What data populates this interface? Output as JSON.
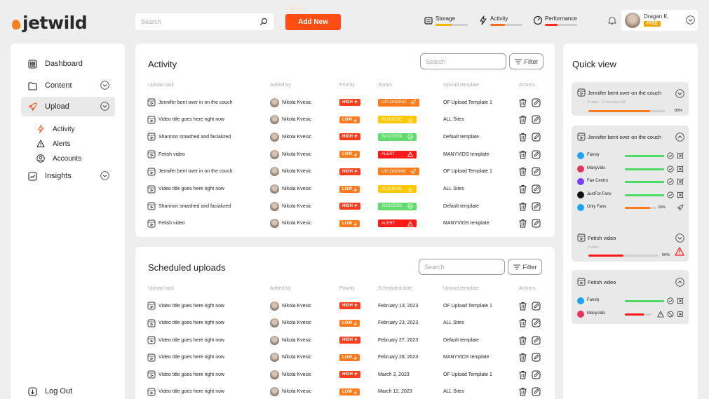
{
  "brand": {
    "name": "jetwild",
    "accent": "#ff4d14"
  },
  "header": {
    "search_placeholder": "Search",
    "ghost_label": "Upload",
    "add_new_label": "Add New",
    "meters": [
      {
        "label": "Storage",
        "icon": "storage-icon",
        "fraction": 0.5,
        "color": "#f5b400"
      },
      {
        "label": "Activity",
        "icon": "activity-icon",
        "fraction": 0.45,
        "color": "#ff6a1a"
      },
      {
        "label": "Performance",
        "icon": "performance-icon",
        "fraction": 0.4,
        "color": "#ff2a1a"
      }
    ],
    "user": {
      "name": "Dragan K.",
      "plan": "FREE"
    }
  },
  "sidebar": {
    "items": [
      {
        "label": "Dashboard",
        "icon": "dashboard-icon"
      },
      {
        "label": "Content",
        "icon": "folder-icon",
        "has_chevron": true
      },
      {
        "label": "Upload",
        "icon": "rocket-icon",
        "has_chevron": true,
        "active": true
      },
      {
        "label": "Insights",
        "icon": "chart-icon",
        "has_chevron": true
      }
    ],
    "sub_items": [
      {
        "label": "Activity",
        "icon": "activity-icon"
      },
      {
        "label": "Alerts",
        "icon": "warning-icon"
      },
      {
        "label": "Accounts",
        "icon": "user-circle-icon"
      }
    ],
    "logout_label": "Log Out"
  },
  "activity": {
    "title": "Activity",
    "search_placeholder": "Search",
    "filter_label": "Filter",
    "columns": [
      "Upload task",
      "Added by",
      "Priority",
      "Status",
      "Upload template",
      "Actions"
    ],
    "rows": [
      {
        "task": "Jennifer bent over in on the couch",
        "added_by": "Nikola Kvesic",
        "priority": "HIGH",
        "status": "UPLOADING",
        "template": "OF Upload Template 1"
      },
      {
        "task": "Video title goes here right now",
        "added_by": "Nikola Kvesic",
        "priority": "LOW",
        "status": "IN QUEUE",
        "template": "ALL Sites"
      },
      {
        "task": "Shannon smashed and facialized",
        "added_by": "Nikola Kvesic",
        "priority": "HIGH",
        "status": "SUCCESS",
        "template": "Default template"
      },
      {
        "task": "Fetish video",
        "added_by": "Nikola Kvesic",
        "priority": "LOW",
        "status": "ALERT",
        "template": "MANYVIDS template"
      },
      {
        "task": "Jennifer bent over in on the couch",
        "added_by": "Nikola Kvesic",
        "priority": "HIGH",
        "status": "UPLOADING",
        "template": "OF Upload Template 1"
      },
      {
        "task": "Video title goes here right now",
        "added_by": "Nikola Kvesic",
        "priority": "LOW",
        "status": "IN QUEUE",
        "template": "ALL Sites"
      },
      {
        "task": "Shannon smashed and facialized",
        "added_by": "Nikola Kvesic",
        "priority": "HIGH",
        "status": "SUCCESS",
        "template": "Default template"
      },
      {
        "task": "Fetish video",
        "added_by": "Nikola Kvesic",
        "priority": "LOW",
        "status": "ALERT",
        "template": "MANYVIDS template"
      }
    ]
  },
  "scheduled": {
    "title": "Scheduled uploads",
    "search_placeholder": "Search",
    "filter_label": "Filter",
    "columns": [
      "Upload task",
      "Added by",
      "Priority",
      "Scheduled date",
      "Upload template",
      "Actions"
    ],
    "rows": [
      {
        "task": "Video title goes here right now",
        "added_by": "Nikola Kvesic",
        "priority": "HIGH",
        "date": "February 13, 2023",
        "template": "OF Upload Template 1"
      },
      {
        "task": "Video title goes here right now",
        "added_by": "Nikola Kvesic",
        "priority": "LOW",
        "date": "February 23, 2023",
        "template": "ALL Sites"
      },
      {
        "task": "Video title goes here right now",
        "added_by": "Nikola Kvesic",
        "priority": "HIGH",
        "date": "February 27, 2023",
        "template": "Default template"
      },
      {
        "task": "Video title goes here right now",
        "added_by": "Nikola Kvesic",
        "priority": "LOW",
        "date": "February 28, 2023",
        "template": "MANYVIDS template"
      },
      {
        "task": "Video title goes here right now",
        "added_by": "Nikola Kvesic",
        "priority": "HIGH",
        "date": "March 3, 2023",
        "template": "OF Upload Template 1"
      },
      {
        "task": "Video title goes here right now",
        "added_by": "Nikola Kvesic",
        "priority": "LOW",
        "date": "March 12, 2023",
        "template": "ALL Sites"
      }
    ]
  },
  "priority_colors": {
    "HIGH": "#ff3b1a",
    "LOW": "#ff7a1a"
  },
  "status_colors": {
    "UPLOADING": "#ff7a1a",
    "IN QUEUE": "#ffc800",
    "SUCCESS": "#5fdc6a",
    "ALERT": "#ff1a1a"
  },
  "quick_view": {
    "title": "Quick view",
    "cards": [
      {
        "title": "Jennifer bent over on the couch",
        "sub": "5 sites - 2 minutes left",
        "progress": 0.8,
        "progress_label": "80%",
        "expanded": false
      },
      {
        "title": "Jennifer bent over on the couch",
        "expanded": true,
        "sites": [
          {
            "name": "Fansly",
            "color": "#1da1f2",
            "progress": 1.0,
            "bar_color": "#4cd964",
            "state": "done"
          },
          {
            "name": "ManyVids",
            "color": "#e8345a",
            "progress": 1.0,
            "bar_color": "#4cd964",
            "state": "done"
          },
          {
            "name": "Fan Centro",
            "color": "#7a3cff",
            "progress": 1.0,
            "bar_color": "#4cd964",
            "state": "done"
          },
          {
            "name": "JustFor.Fans",
            "color": "#111111",
            "progress": 1.0,
            "bar_color": "#4cd964",
            "state": "done"
          },
          {
            "name": "Only Fans",
            "color": "#1aa3ff",
            "progress": 0.8,
            "bar_color": "#ff7a1a",
            "state": "uploading",
            "progress_label": "80%"
          }
        ]
      },
      {
        "title": "Fetish video",
        "sub": "2 sites",
        "progress": 0.5,
        "progress_label": "50%",
        "expanded": false,
        "alert": true
      },
      {
        "title": "Fetish video",
        "expanded": true,
        "sites": [
          {
            "name": "Fansly",
            "color": "#1da1f2",
            "progress": 1.0,
            "bar_color": "#4cd964",
            "state": "done"
          },
          {
            "name": "ManyVids",
            "color": "#e8345a",
            "progress": 0.7,
            "bar_color": "#ff1a1a",
            "state": "alert"
          }
        ]
      }
    ]
  }
}
